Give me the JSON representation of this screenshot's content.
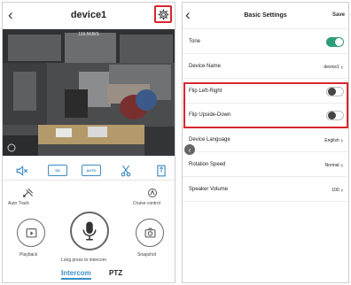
{
  "left_screen": {
    "title": "device1",
    "icons": {
      "back": "chevron-left-icon",
      "settings": "gear-icon"
    },
    "video": {
      "bitrate": "119.5KB/S"
    },
    "control_bar": {
      "hd_label": "SD",
      "auto_label": "AUTO"
    },
    "functions": {
      "auto_track": "Auto Track",
      "cruise_control": "Cruise control",
      "playback": "Playback",
      "snapshot": "Snapshot",
      "intercom_hint": "Long press to intercom"
    },
    "tabs": [
      {
        "label": "Intercom",
        "active": true
      },
      {
        "label": "PTZ",
        "active": false
      }
    ]
  },
  "right_screen": {
    "title": "Basic Settings",
    "save_label": "Save",
    "settings": [
      {
        "label": "Tone",
        "type": "toggle",
        "on": true
      },
      {
        "label": "Device Name",
        "type": "value",
        "value": "device1"
      },
      {
        "label": "Flip Left-Right",
        "type": "toggle",
        "on": false
      },
      {
        "label": "Flip Upside-Down",
        "type": "toggle",
        "on": false
      },
      {
        "label": "Device Language",
        "type": "value",
        "value": "English"
      },
      {
        "label": "Rotation Speed",
        "type": "value",
        "value": "Normal"
      },
      {
        "label": "Speaker Volume",
        "type": "value",
        "value": "100"
      }
    ]
  },
  "colors": {
    "accent_blue": "#3a8fc8",
    "toggle_on": "#2e9e7a",
    "highlight_red": "#d8262e"
  }
}
